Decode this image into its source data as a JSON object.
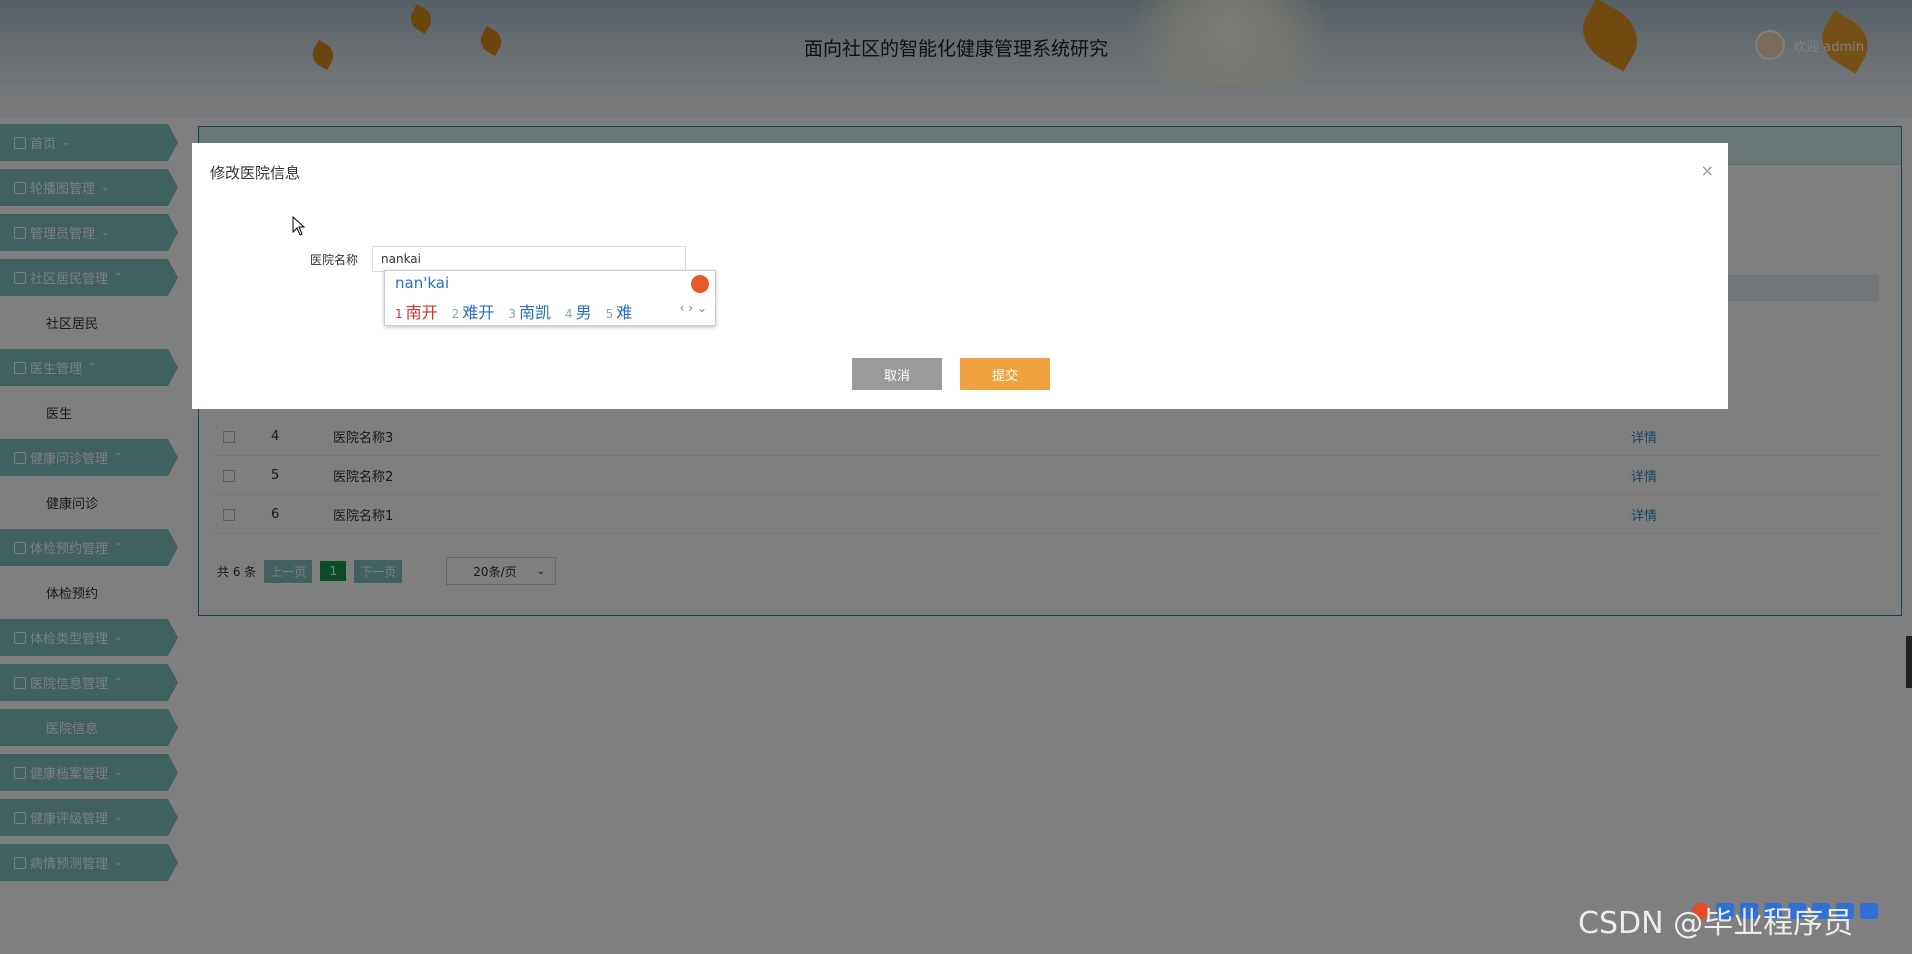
{
  "header": {
    "title": "面向社区的智能化健康管理系统研究",
    "user_label": "欢迎 admin"
  },
  "sidebar": {
    "items": [
      {
        "label": "首页",
        "type": "menu"
      },
      {
        "label": "轮播图管理",
        "type": "menu"
      },
      {
        "label": "管理员管理",
        "type": "menu"
      },
      {
        "label": "社区居民管理",
        "type": "menu"
      },
      {
        "label": "社区居民",
        "type": "sub"
      },
      {
        "label": "医生管理",
        "type": "menu"
      },
      {
        "label": "医生",
        "type": "sub"
      },
      {
        "label": "健康问诊管理",
        "type": "menu"
      },
      {
        "label": "健康问诊",
        "type": "sub"
      },
      {
        "label": "体检预约管理",
        "type": "menu"
      },
      {
        "label": "体检预约",
        "type": "sub"
      },
      {
        "label": "体检类型管理",
        "type": "menu"
      },
      {
        "label": "医院信息管理",
        "type": "menu"
      },
      {
        "label": "医院信息",
        "type": "sub-active"
      },
      {
        "label": "健康档案管理",
        "type": "menu"
      },
      {
        "label": "健康评级管理",
        "type": "menu"
      },
      {
        "label": "病情预测管理",
        "type": "menu"
      }
    ]
  },
  "table": {
    "rows": [
      {
        "num": "4",
        "name": "医院名称3",
        "action": "详情"
      },
      {
        "num": "5",
        "name": "医院名称2",
        "action": "详情"
      },
      {
        "num": "6",
        "name": "医院名称1",
        "action": "详情"
      }
    ]
  },
  "pager": {
    "total": "共 6 条",
    "prev": "上一页",
    "current": "1",
    "next": "下一页",
    "page_size": "20条/页"
  },
  "modal": {
    "title": "修改医院信息",
    "close": "×",
    "field_label": "医院名称",
    "field_value": "nankai",
    "cancel": "取消",
    "submit": "提交"
  },
  "ime": {
    "composition": "nan'kai",
    "candidates": [
      {
        "n": "1",
        "text": "南开"
      },
      {
        "n": "2",
        "text": "难开"
      },
      {
        "n": "3",
        "text": "南凯"
      },
      {
        "n": "4",
        "text": "男"
      },
      {
        "n": "5",
        "text": "难"
      }
    ],
    "nav": "‹ › ⌄"
  },
  "watermark": "CSDN @毕业程序员"
}
